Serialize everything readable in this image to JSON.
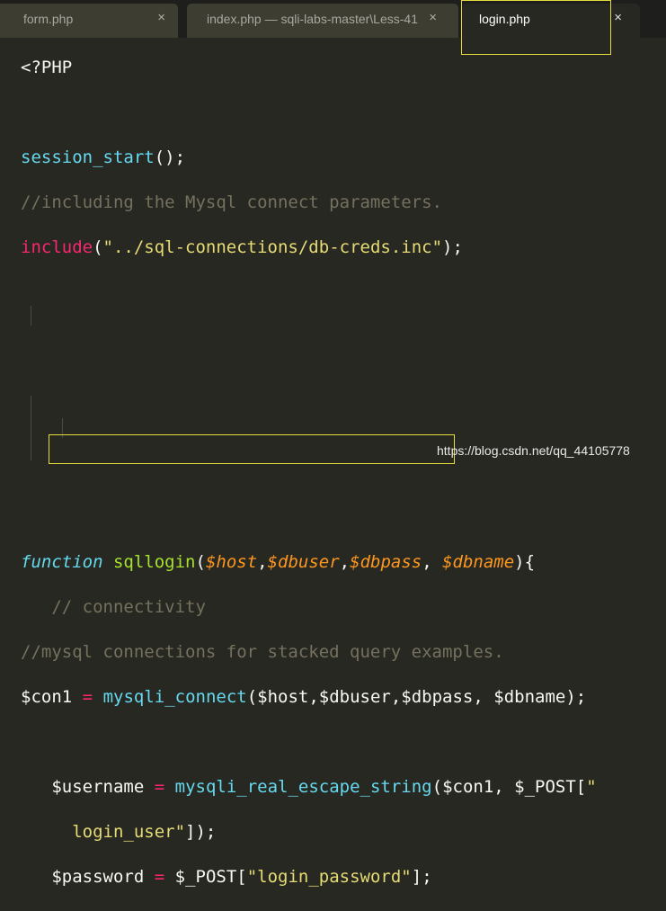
{
  "tabs": [
    {
      "label": "form.php",
      "close": "×"
    },
    {
      "label": "index.php — sqli-labs-master\\Less-41",
      "close": "×"
    },
    {
      "label": "login.php",
      "close": "×"
    }
  ],
  "code": {
    "l1": "<?PHP",
    "l3_fn": "session_start",
    "l3_rest": "();",
    "l4": "//including the Mysql connect parameters.",
    "l5_kw": "include",
    "l5_open": "(",
    "l5_str": "\"../sql-connections/db-creds.inc\"",
    "l5_close": ");",
    "l12_kw": "function",
    "l12_name": "sqllogin",
    "l12_open": "(",
    "l12_a1": "$host",
    "l12_a2": "$dbuser",
    "l12_a3": "$dbpass",
    "l12_a4": "$dbname",
    "l12_close": "){",
    "l13": "// connectivity",
    "l14": "//mysql connections for stacked query examples.",
    "l15_var": "$con1",
    "l15_eq": "=",
    "l15_fn": "mysqli_connect",
    "l15_args": "($host,$dbuser,$dbpass, $dbname);",
    "l17_var": "$username",
    "l17_eq": "=",
    "l17_fn": "mysqli_real_escape_string",
    "l17_args": "($con1, $_POST[",
    "l17_str": "\"",
    "l18_str": "login_user\"",
    "l18_rest": "]);",
    "l19_var": "$password",
    "l19_eq": "=",
    "l19_post": "$_POST[",
    "l19_str": "\"login_password\"",
    "l19_rest": "];"
  },
  "watermark": "https://blog.csdn.net/qq_44105778"
}
